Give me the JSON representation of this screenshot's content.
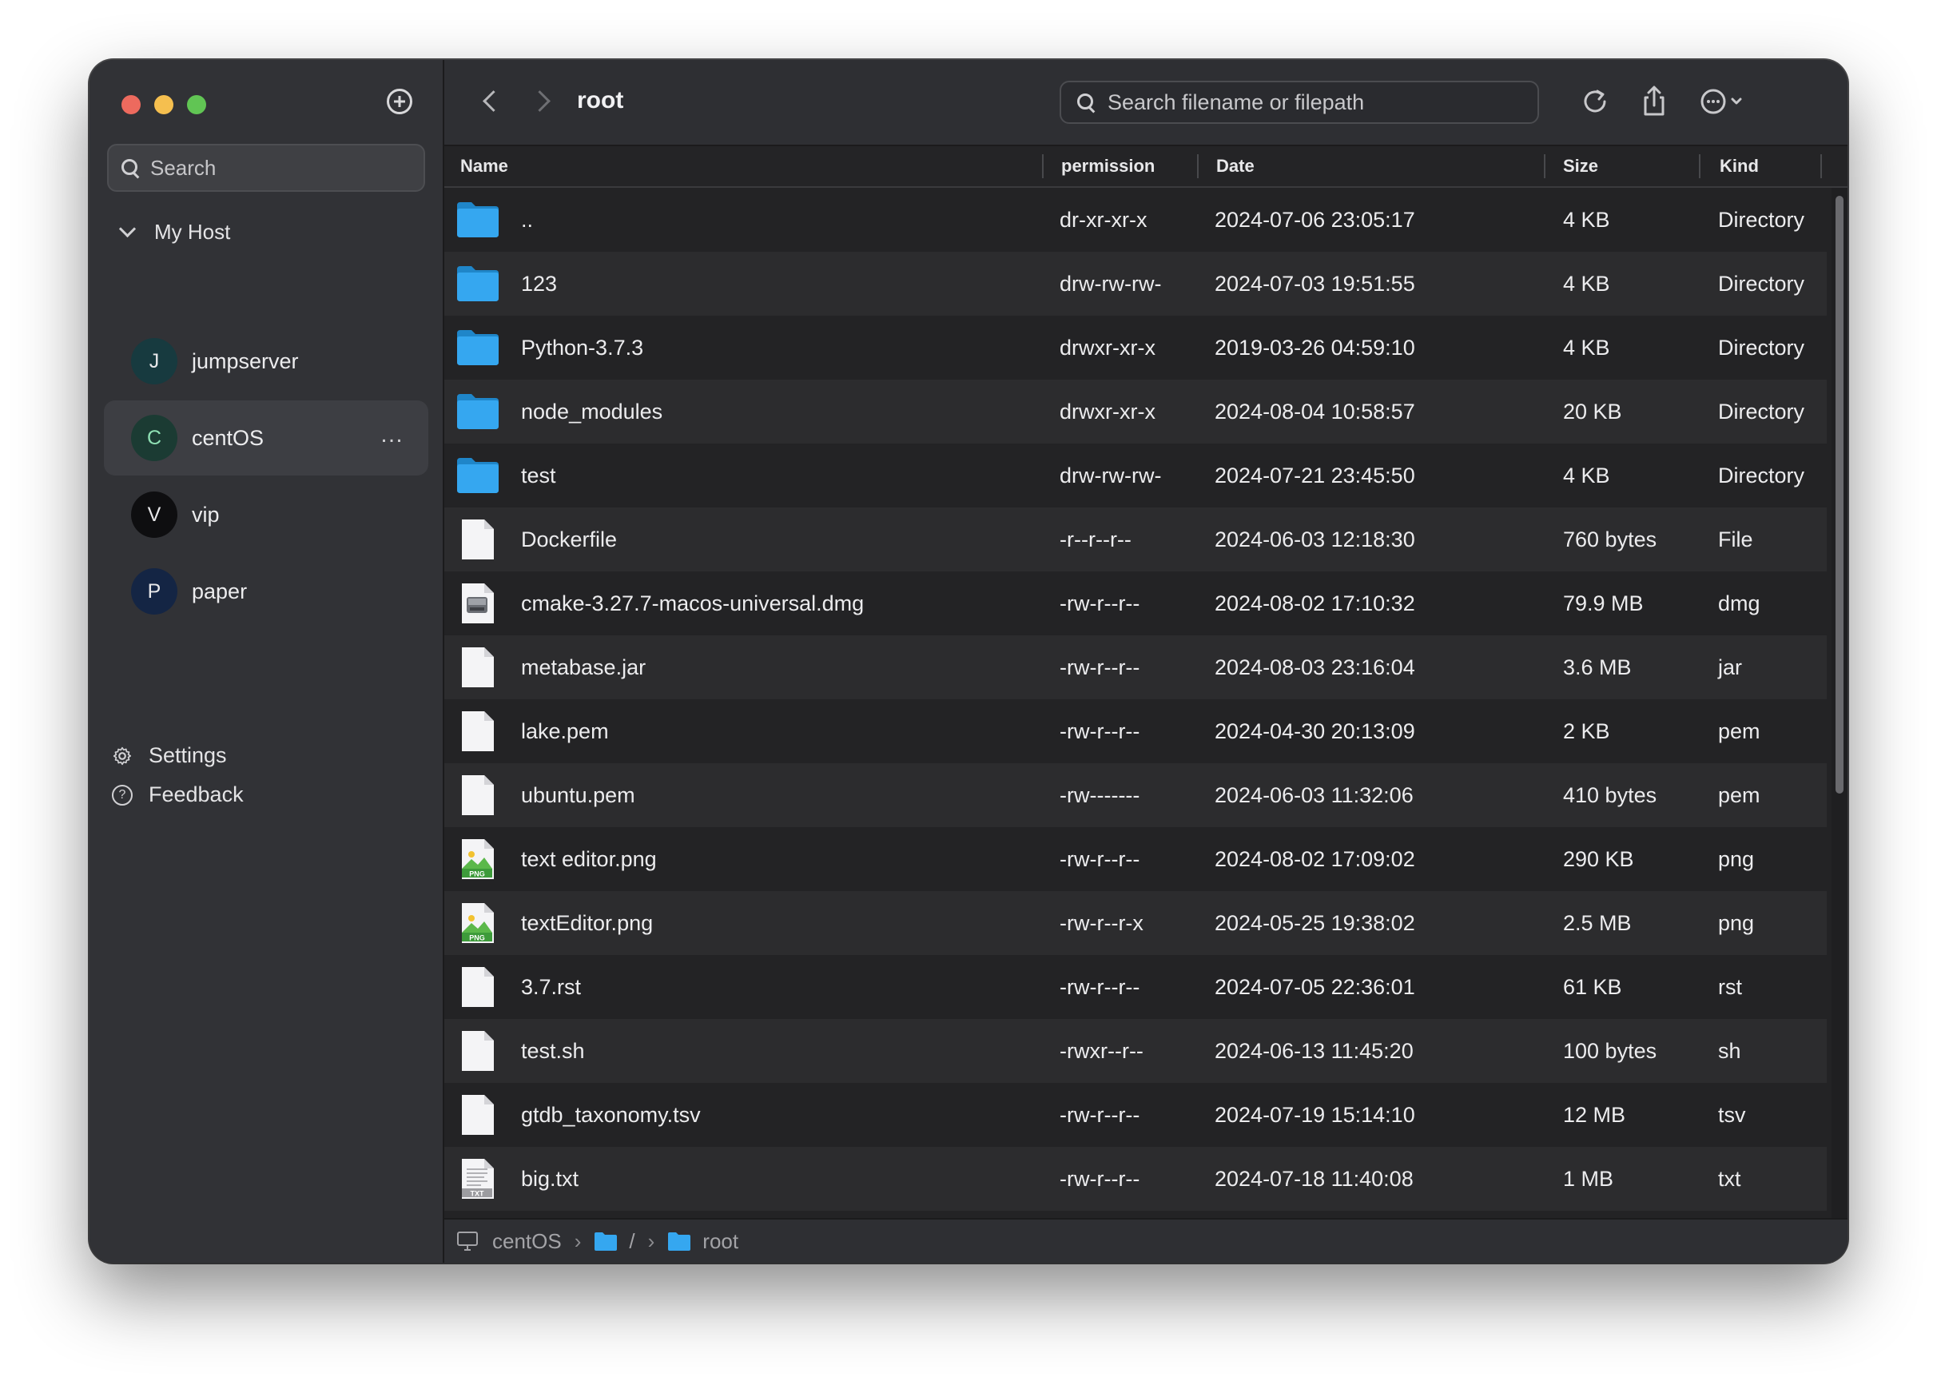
{
  "sidebar": {
    "search_placeholder": "Search",
    "group_label": "My Host",
    "hosts": [
      {
        "initial": "J",
        "name": "jumpserver",
        "avatar_bg": "#173a3f",
        "avatar_fg": "#e8e8ea"
      },
      {
        "initial": "C",
        "name": "centOS",
        "avatar_bg": "#1b3b33",
        "avatar_fg": "#8fe0b4",
        "active": true,
        "more": "…"
      },
      {
        "initial": "V",
        "name": "vip",
        "avatar_bg": "#0e0e10",
        "avatar_fg": "#e8e8ea"
      },
      {
        "initial": "P",
        "name": "paper",
        "avatar_bg": "#142544",
        "avatar_fg": "#e8e8ea"
      }
    ],
    "settings_label": "Settings",
    "feedback_label": "Feedback"
  },
  "toolbar": {
    "title": "root",
    "search_placeholder": "Search filename or filepath"
  },
  "table": {
    "headers": {
      "name": "Name",
      "permission": "permission",
      "date": "Date",
      "size": "Size",
      "kind": "Kind"
    },
    "rows": [
      {
        "icon": "folder",
        "name": "..",
        "permission": "dr-xr-xr-x",
        "date": "2024-07-06 23:05:17",
        "size": "4 KB",
        "kind": "Directory"
      },
      {
        "icon": "folder",
        "name": "123",
        "permission": "drw-rw-rw-",
        "date": "2024-07-03 19:51:55",
        "size": "4 KB",
        "kind": "Directory"
      },
      {
        "icon": "folder",
        "name": "Python-3.7.3",
        "permission": "drwxr-xr-x",
        "date": "2019-03-26 04:59:10",
        "size": "4 KB",
        "kind": "Directory"
      },
      {
        "icon": "folder",
        "name": "node_modules",
        "permission": "drwxr-xr-x",
        "date": "2024-08-04 10:58:57",
        "size": "20 KB",
        "kind": "Directory"
      },
      {
        "icon": "folder",
        "name": "test",
        "permission": "drw-rw-rw-",
        "date": "2024-07-21 23:45:50",
        "size": "4 KB",
        "kind": "Directory"
      },
      {
        "icon": "file",
        "name": "Dockerfile",
        "permission": "-r--r--r--",
        "date": "2024-06-03 12:18:30",
        "size": "760 bytes",
        "kind": "File"
      },
      {
        "icon": "dmg",
        "name": "cmake-3.27.7-macos-universal.dmg",
        "permission": "-rw-r--r--",
        "date": "2024-08-02 17:10:32",
        "size": "79.9 MB",
        "kind": "dmg"
      },
      {
        "icon": "file",
        "name": "metabase.jar",
        "permission": "-rw-r--r--",
        "date": "2024-08-03 23:16:04",
        "size": "3.6 MB",
        "kind": "jar"
      },
      {
        "icon": "file",
        "name": "lake.pem",
        "permission": "-rw-r--r--",
        "date": "2024-04-30 20:13:09",
        "size": "2 KB",
        "kind": "pem"
      },
      {
        "icon": "file",
        "name": "ubuntu.pem",
        "permission": "-rw-------",
        "date": "2024-06-03 11:32:06",
        "size": "410 bytes",
        "kind": "pem"
      },
      {
        "icon": "png",
        "name": "text editor.png",
        "permission": "-rw-r--r--",
        "date": "2024-08-02 17:09:02",
        "size": "290 KB",
        "kind": "png"
      },
      {
        "icon": "png",
        "name": "textEditor.png",
        "permission": "-rw-r--r-x",
        "date": "2024-05-25 19:38:02",
        "size": "2.5 MB",
        "kind": "png"
      },
      {
        "icon": "file",
        "name": "3.7.rst",
        "permission": "-rw-r--r--",
        "date": "2024-07-05 22:36:01",
        "size": "61 KB",
        "kind": "rst"
      },
      {
        "icon": "file",
        "name": "test.sh",
        "permission": "-rwxr--r--",
        "date": "2024-06-13 11:45:20",
        "size": "100 bytes",
        "kind": "sh"
      },
      {
        "icon": "file",
        "name": "gtdb_taxonomy.tsv",
        "permission": "-rw-r--r--",
        "date": "2024-07-19 15:14:10",
        "size": "12 MB",
        "kind": "tsv"
      },
      {
        "icon": "txt",
        "name": "big.txt",
        "permission": "-rw-r--r--",
        "date": "2024-07-18 11:40:08",
        "size": "1 MB",
        "kind": "txt"
      }
    ]
  },
  "statusbar": {
    "host": "centOS",
    "root_sep": "/",
    "current": "root"
  },
  "icon_labels": {
    "png": "PNG",
    "txt": "TXT",
    "terminal": ">_"
  },
  "colors": {
    "folder": "#35a7f0",
    "accent_green": "#8fe0b4"
  }
}
